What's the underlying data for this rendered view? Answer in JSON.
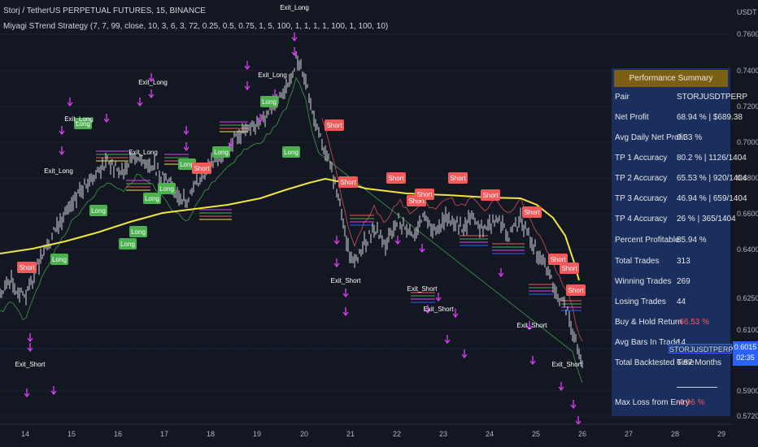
{
  "header": {
    "title": "Storj / TetherUS PERPETUAL FUTURES, 15, BINANCE",
    "strategy": "Miyagi STrend Strategy (7, 7, 99, close, 10, 3, 6, 3, 72, 0.25, 0.5, 0.75, 1, 5, 100, 1, 1, 1, 1, 100, 1, 100, 10)"
  },
  "price_axis": {
    "currency": "USDT",
    "ticks": [
      "0.7600",
      "0.7400",
      "0.7200",
      "0.7000",
      "0.6800",
      "0.6600",
      "0.6400",
      "0.6250",
      "0.6100",
      "0.5900",
      "0.5720"
    ],
    "last_price": "0.6015",
    "countdown": "02:35",
    "symbol_tag": "STORJUSDTPERP"
  },
  "time_axis": {
    "ticks": [
      "14",
      "15",
      "16",
      "17",
      "18",
      "19",
      "20",
      "21",
      "22",
      "23",
      "24",
      "25",
      "26",
      "27",
      "28",
      "29"
    ]
  },
  "signals": {
    "long": "Long",
    "short": "Short",
    "exit_long": "Exit_Long",
    "exit_short": "Exit_Short"
  },
  "performance": {
    "title": "Performance Summary",
    "rows": [
      {
        "label": "Pair",
        "value": "STORJUSDTPERP"
      },
      {
        "label": "Net Profit",
        "value": "68.94 % | $689.38"
      },
      {
        "label": "Avg Daily Net Profit",
        "value": "0.33 %"
      },
      {
        "label": "TP 1 Accuracy",
        "value": "80.2 % | 1126/1404"
      },
      {
        "label": "TP 2 Accuracy",
        "value": "65.53 % | 920/1404"
      },
      {
        "label": "TP 3 Accuracy",
        "value": "46.94 % | 659/1404"
      },
      {
        "label": "TP 4 Accuracy",
        "value": "26 % | 365/1404"
      },
      {
        "label": "Percent Profitable",
        "value": "85.94 %"
      },
      {
        "label": "Total Trades",
        "value": "313"
      },
      {
        "label": "Winning Trades",
        "value": "269"
      },
      {
        "label": "Losing Trades",
        "value": "44"
      },
      {
        "label": "Buy & Hold Return",
        "value": "-66.53 %"
      },
      {
        "label": "Avg Bars In Trade",
        "value": "14"
      },
      {
        "label": "Total Backtested Time",
        "value": "6.87 Months"
      },
      {
        "label": "Max Loss from Entry",
        "value": "-4.96 %"
      }
    ]
  },
  "colors": {
    "background": "#131722",
    "candle": "#d1d4dc",
    "ema": "#f0e442",
    "long_label": "#4caf50",
    "short_label": "#f05a5a",
    "exit_marker": "#e040fb",
    "panel_bg": "#1a2f5e",
    "panel_header": "#7d5f14",
    "last_price": "#2962ff"
  }
}
